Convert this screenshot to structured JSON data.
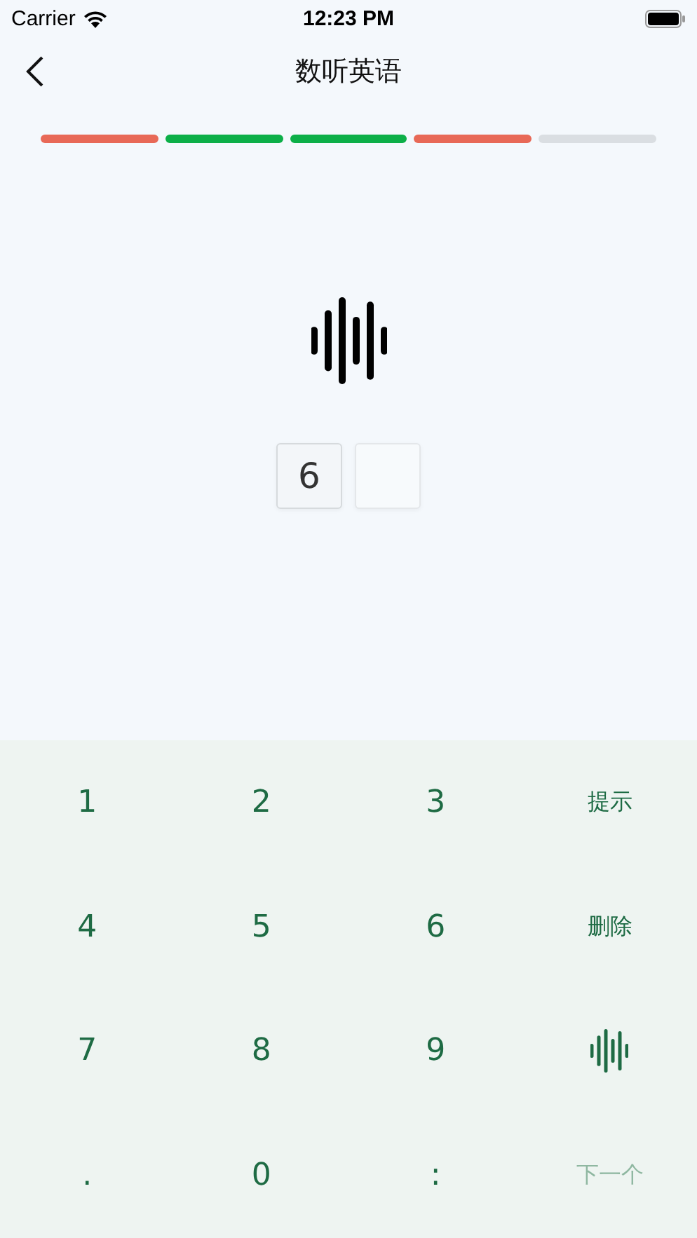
{
  "status_bar": {
    "carrier": "Carrier",
    "time": "12:23 PM"
  },
  "nav": {
    "title": "数听英语"
  },
  "progress": [
    {
      "color": "#e86957"
    },
    {
      "color": "#0caf48"
    },
    {
      "color": "#0caf48"
    },
    {
      "color": "#e86957"
    },
    {
      "color": "#dadee2"
    }
  ],
  "answer_boxes": [
    {
      "filled": true,
      "value": "6"
    },
    {
      "filled": false
    }
  ],
  "keypad": [
    {
      "kind": "text",
      "label": "1",
      "disabled": false
    },
    {
      "kind": "text",
      "label": "2",
      "disabled": false
    },
    {
      "kind": "text",
      "label": "3",
      "disabled": false
    },
    {
      "kind": "text",
      "label": "提示",
      "disabled": false
    },
    {
      "kind": "text",
      "label": "4",
      "disabled": false
    },
    {
      "kind": "text",
      "label": "5",
      "disabled": false
    },
    {
      "kind": "text",
      "label": "6",
      "disabled": false
    },
    {
      "kind": "text",
      "label": "删除",
      "disabled": false
    },
    {
      "kind": "text",
      "label": "7",
      "disabled": false
    },
    {
      "kind": "text",
      "label": "8",
      "disabled": false
    },
    {
      "kind": "text",
      "label": "9",
      "disabled": false
    },
    {
      "kind": "audio",
      "disabled": false
    },
    {
      "kind": "text",
      "label": ".",
      "disabled": false
    },
    {
      "kind": "text",
      "label": "0",
      "disabled": false
    },
    {
      "kind": "text",
      "label": ":",
      "disabled": false
    },
    {
      "kind": "text",
      "label": "下一个",
      "disabled": true
    }
  ]
}
